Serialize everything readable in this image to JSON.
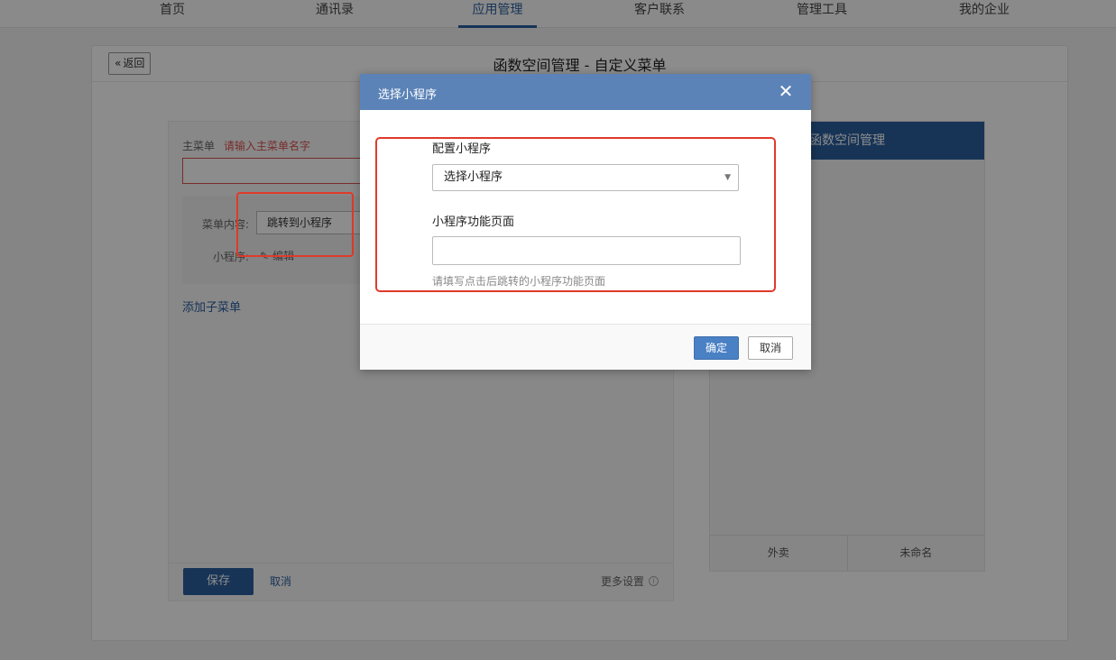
{
  "nav": {
    "items": [
      "首页",
      "通讯录",
      "应用管理",
      "客户联系",
      "管理工具",
      "我的企业"
    ],
    "active_index": 2
  },
  "panel": {
    "back_label": "返回",
    "title": "函数空间管理 - 自定义菜单"
  },
  "editor": {
    "main_menu_label": "主菜单",
    "main_menu_warning": "请输入主菜单名字",
    "content_label": "菜单内容:",
    "content_value": "跳转到小程序",
    "mini_program_label": "小程序:",
    "edit_label": "编辑",
    "add_submenu": "添加子菜单",
    "save_button": "保存",
    "cancel_link": "取消",
    "more_settings": "更多设置"
  },
  "preview": {
    "header_title": "函数空间管理",
    "tabs": [
      "外卖",
      "未命名"
    ]
  },
  "modal": {
    "title": "选择小程序",
    "close_icon": "close-icon",
    "config_label": "配置小程序",
    "select_value": "选择小程序",
    "page_label": "小程序功能页面",
    "page_input_value": "",
    "hint": "请填写点击后跳转的小程序功能页面",
    "ok_button": "确定",
    "cancel_button": "取消"
  },
  "colors": {
    "brand": "#2b5f9e",
    "modal_header": "#5b83b7",
    "highlight": "#e03a2a",
    "warning": "#d9534f"
  }
}
